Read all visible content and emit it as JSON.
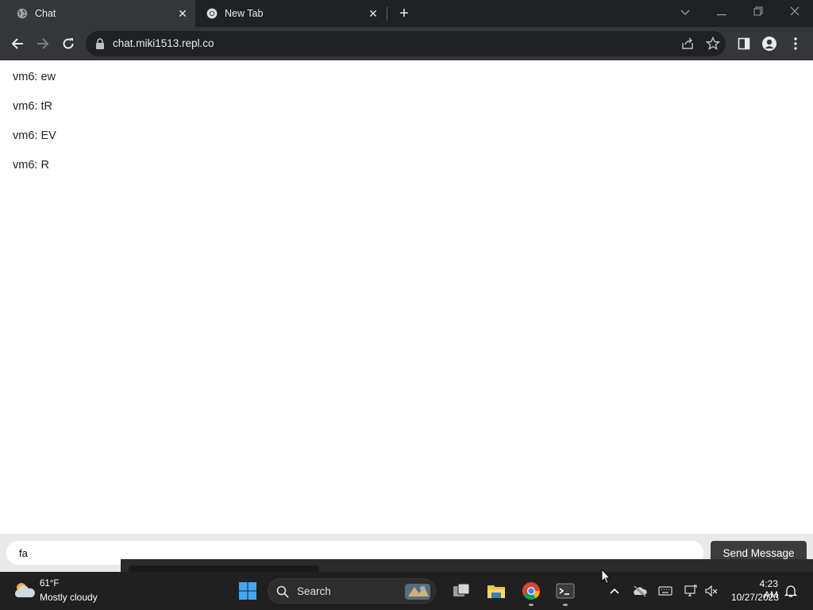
{
  "browser": {
    "tabs": [
      {
        "title": "Chat",
        "active": true,
        "favicon": "globe-icon"
      },
      {
        "title": "New Tab",
        "active": false,
        "favicon": "chrome-icon"
      }
    ],
    "address": "chat.miki1513.repl.co"
  },
  "chat": {
    "messages": [
      "vm6: ew",
      "vm6: tR",
      "vm6: EV",
      "vm6: R"
    ],
    "input_value": "fa",
    "send_label": "Send Message"
  },
  "taskbar": {
    "weather": {
      "temp": "61°F",
      "desc": "Mostly cloudy"
    },
    "search_label": "Search",
    "clock": {
      "time": "4:23 AM",
      "date": "10/27/2023"
    }
  },
  "colors": {
    "tabstrip_bg": "#202124",
    "toolbar_bg": "#35363a",
    "send_button_bg": "#3c3c3c",
    "taskbar_bg": "#202020"
  }
}
